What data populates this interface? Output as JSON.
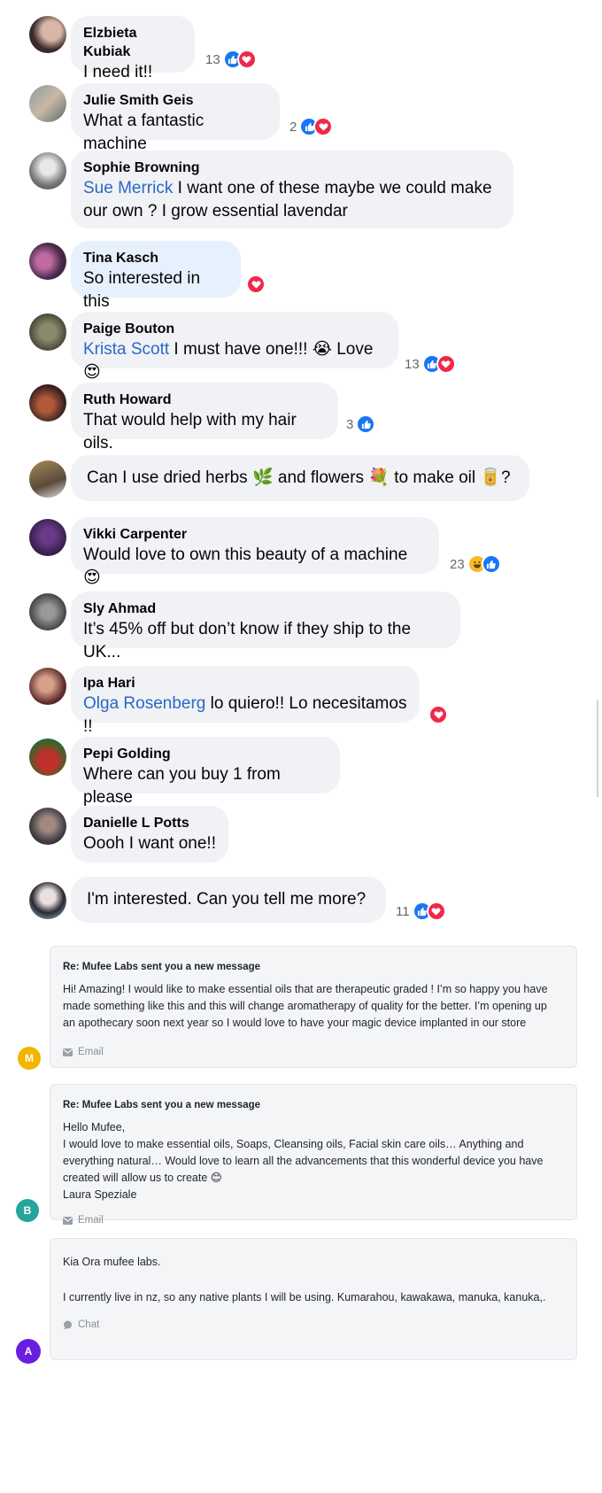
{
  "comments": [
    {
      "author": "Elzbieta Kubiak",
      "mention": "",
      "text": "I need it!!",
      "reaction_count": "13",
      "reactions": [
        "like-icon",
        "love-icon"
      ]
    },
    {
      "author": "Julie Smith Geis",
      "mention": "",
      "text": "What a fantastic machine",
      "reaction_count": "2",
      "reactions": [
        "like-icon",
        "love-icon"
      ]
    },
    {
      "author": "Sophie Browning",
      "mention": "Sue Merrick",
      "text": " I want one of these maybe we could make our own ? I grow essential lavendar",
      "reaction_count": "",
      "reactions": []
    },
    {
      "author": "Tina Kasch",
      "mention": "",
      "text": "So interested in this",
      "reaction_count": "",
      "reactions": [
        "love-icon"
      ]
    },
    {
      "author": "Paige Bouton",
      "mention": "Krista Scott",
      "text": " I must have one!!! 😭 Love 😍",
      "reaction_count": "13",
      "reactions": [
        "like-icon",
        "love-icon"
      ]
    },
    {
      "author": "Ruth Howard",
      "mention": "",
      "text": "That would help with my hair oils.",
      "reaction_count": "3",
      "reactions": [
        "like-icon"
      ]
    },
    {
      "author": "",
      "mention": "",
      "text": "Can I use dried herbs 🌿 and flowers 💐 to make oil 🥫?",
      "reaction_count": "",
      "reactions": []
    },
    {
      "author": "Vikki Carpenter",
      "mention": "",
      "text": "Would love to own this beauty of a machine 😍",
      "reaction_count": "23",
      "reactions": [
        "haha-icon",
        "like-icon"
      ]
    },
    {
      "author": "Sly Ahmad",
      "mention": "",
      "text": "It’s 45% off but don’t know if they ship to the UK...",
      "reaction_count": "",
      "reactions": []
    },
    {
      "author": "Ipa Hari",
      "mention": "Olga Rosenberg",
      "text": " lo quiero!! Lo necesitamos !!",
      "reaction_count": "",
      "reactions": [
        "love-icon"
      ]
    },
    {
      "author": "Pepi Golding",
      "mention": "",
      "text": "Where can you buy 1 from please",
      "reaction_count": "",
      "reactions": []
    },
    {
      "author": "Danielle L Potts",
      "mention": "",
      "text": "Oooh I want one!!",
      "reaction_count": "",
      "reactions": []
    },
    {
      "author": "",
      "mention": "",
      "text": "I'm interested. Can you tell me more?",
      "reaction_count": "11",
      "reactions": [
        "like-icon",
        "love-icon"
      ]
    }
  ],
  "messages": [
    {
      "subject": "Re: Mufee Labs sent you a new message",
      "body": "Hi! Amazing! I would like to make essential oils that are therapeutic graded ! I’m so happy you have made something like this and this will change aromatherapy of quality for the better. I’m opening up an apothecary soon next year so I would love to have your magic device implanted in our store",
      "source": "Email",
      "initial": "M",
      "initial_color": "#f4b400"
    },
    {
      "subject": "Re: Mufee Labs sent you a new message",
      "body": "Hello Mufee,\nI would love to make essential oils, Soaps, Cleansing oils, Facial skin care oils… Anything and everything natural… Would love to learn all the advancements that this wonderful device you have created will allow us to create 😊\nLaura Speziale",
      "source": "Email",
      "initial": "B",
      "initial_color": "#26a69a"
    },
    {
      "subject": "",
      "body": "Kia Ora mufee labs.\n\nI currently live in nz, so any native plants I will be using. Kumarahou, kawakawa, manuka, kanuka,.",
      "source": "Chat",
      "initial": "A",
      "initial_color": "#6a1fe0"
    }
  ]
}
